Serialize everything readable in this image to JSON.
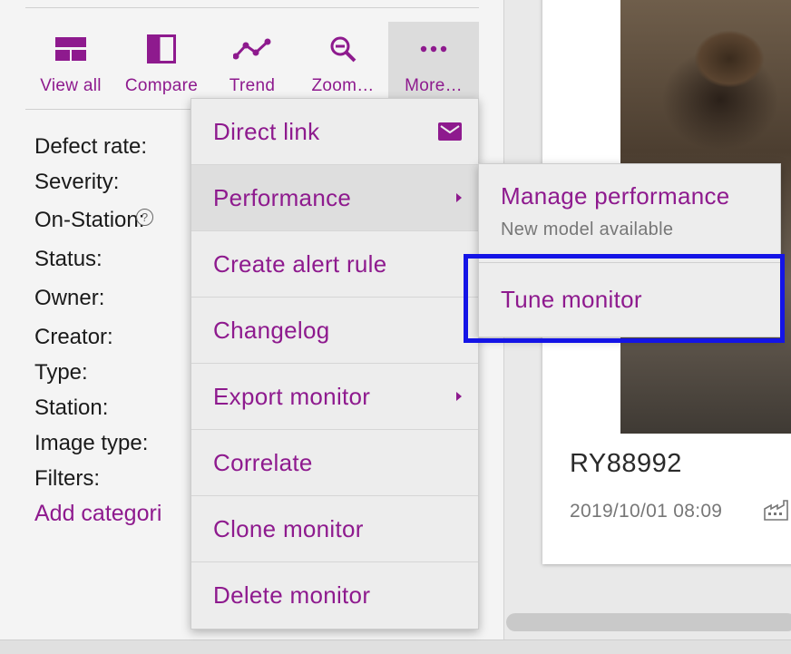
{
  "toolbar": {
    "items": [
      {
        "label": "View all",
        "icon": "view-all-icon"
      },
      {
        "label": "Compare",
        "icon": "compare-icon"
      },
      {
        "label": "Trend",
        "icon": "trend-icon"
      },
      {
        "label": "Zoom…",
        "icon": "zoom-icon"
      },
      {
        "label": "More…",
        "icon": "more-icon"
      }
    ]
  },
  "fields": [
    "Defect rate:",
    "Severity:",
    "On-Station:",
    "Status:",
    "Owner:",
    "Creator:",
    "Type:",
    "Station:",
    "Image type:",
    "Filters:"
  ],
  "help_glyph": "?",
  "add_categories_label": "Add categori",
  "menu": {
    "items": [
      {
        "label": "Direct link",
        "trailing": "mail-icon"
      },
      {
        "label": "Performance",
        "trailing": "submenu-caret"
      },
      {
        "label": "Create alert rule"
      },
      {
        "label": "Changelog"
      },
      {
        "label": "Export monitor",
        "trailing": "submenu-caret"
      },
      {
        "label": "Correlate"
      },
      {
        "label": "Clone monitor"
      },
      {
        "label": "Delete monitor"
      }
    ]
  },
  "submenu": {
    "manage": {
      "title": "Manage performance",
      "desc": "New model available"
    },
    "tune": {
      "title": "Tune monitor"
    }
  },
  "card": {
    "title": "RY88992",
    "date": "2019/10/01 08:09"
  },
  "colors": {
    "accent": "#8e1a8e",
    "highlight": "#1414e6"
  }
}
